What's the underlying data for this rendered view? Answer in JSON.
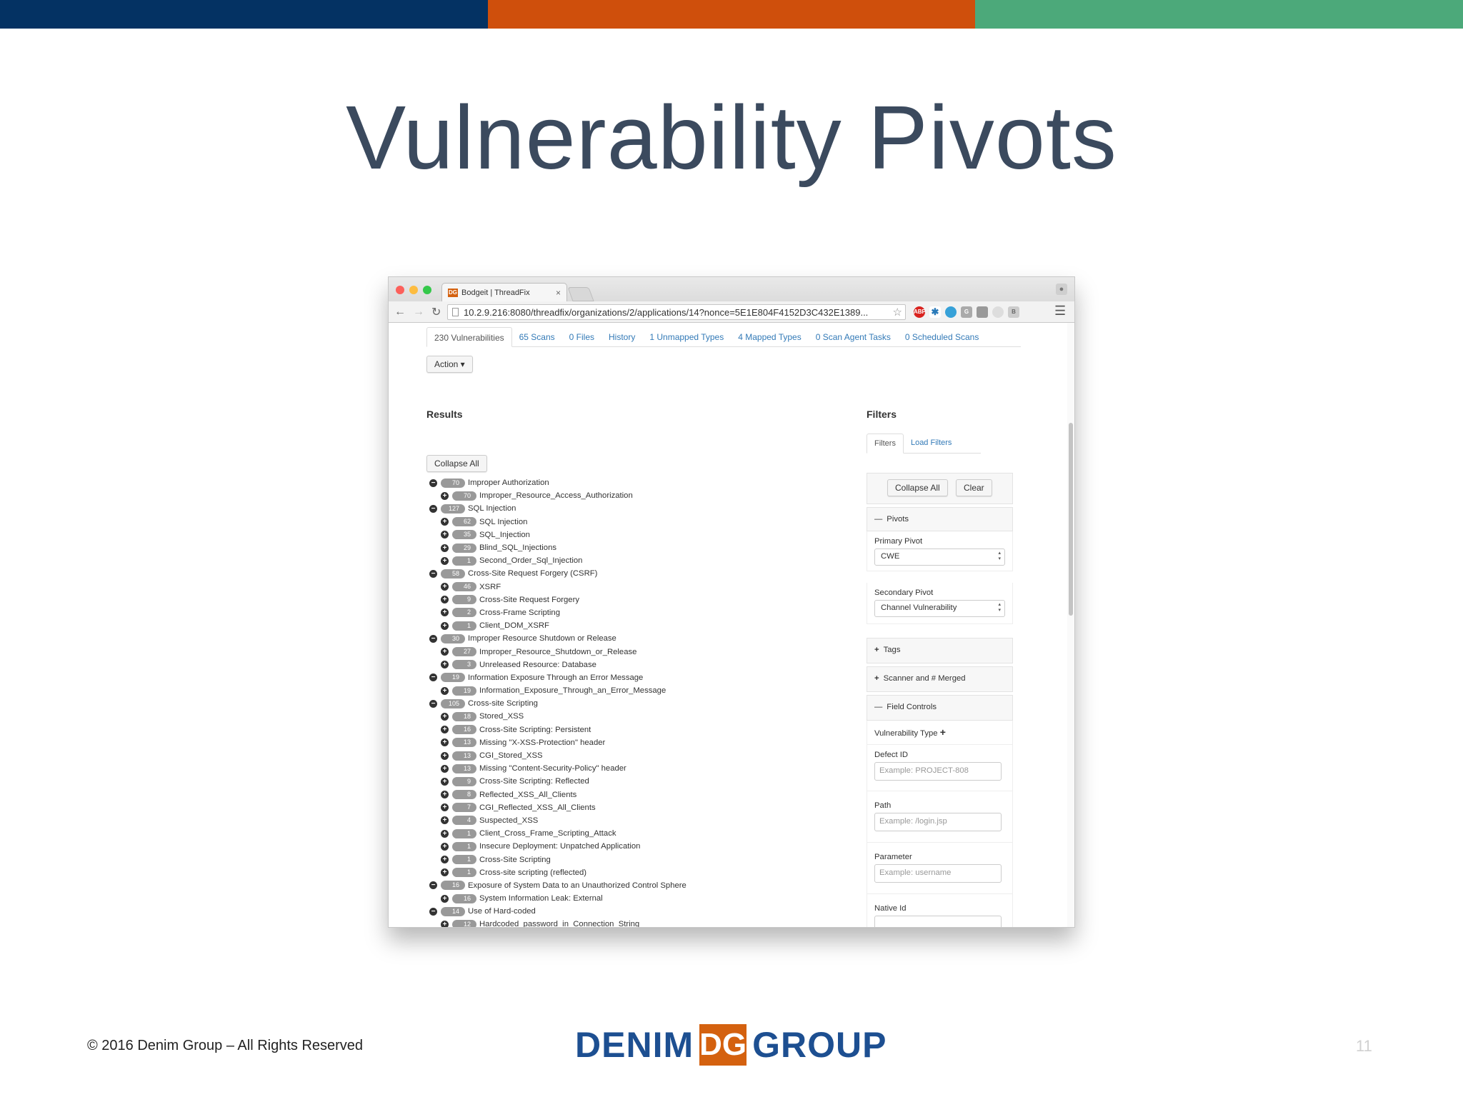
{
  "colors": {
    "bar_navy": "#043263",
    "bar_orange": "#cf4f0c",
    "bar_green": "#4ca97a",
    "link": "#337ab7",
    "logo_blue": "#1d4f91",
    "logo_orange": "#d4610f"
  },
  "slide": {
    "title": "Vulnerability Pivots",
    "footer": "© 2016 Denim Group – All Rights Reserved",
    "page_number": "11"
  },
  "logo": {
    "left_word": "DENIM",
    "right_word": "GROUP",
    "mark_text": "DG"
  },
  "browser": {
    "tab_title": "Bodgeit | ThreadFix",
    "tab_favicon": "DG",
    "tab_close": "×",
    "url": "10.2.9.216:8080/threadfix/organizations/2/applications/14?nonce=5E1E804F4152D3C432E1389...",
    "extensions": [
      "adblock-icon",
      "molecule-icon",
      "globe-icon",
      "g-icon",
      "square-icon",
      "moon-icon",
      "b-icon"
    ]
  },
  "app": {
    "tabs": [
      "230 Vulnerabilities",
      "65 Scans",
      "0 Files",
      "History",
      "1 Unmapped Types",
      "4 Mapped Types",
      "0 Scan Agent Tasks",
      "0 Scheduled Scans"
    ],
    "action_label": "Action ▾",
    "results_heading": "Results",
    "collapse_all": "Collapse All",
    "tree": [
      {
        "level": 0,
        "count": "70",
        "label": "Improper Authorization"
      },
      {
        "level": 1,
        "count": "70",
        "label": "Improper_Resource_Access_Authorization"
      },
      {
        "level": 0,
        "count": "127",
        "label": "SQL Injection"
      },
      {
        "level": 1,
        "count": "62",
        "label": "SQL Injection"
      },
      {
        "level": 1,
        "count": "35",
        "label": "SQL_Injection"
      },
      {
        "level": 1,
        "count": "29",
        "label": "Blind_SQL_Injections"
      },
      {
        "level": 1,
        "count": "1",
        "label": "Second_Order_Sql_Injection"
      },
      {
        "level": 0,
        "count": "58",
        "label": "Cross-Site Request Forgery (CSRF)"
      },
      {
        "level": 1,
        "count": "46",
        "label": "XSRF"
      },
      {
        "level": 1,
        "count": "9",
        "label": "Cross-Site Request Forgery"
      },
      {
        "level": 1,
        "count": "2",
        "label": "Cross-Frame Scripting"
      },
      {
        "level": 1,
        "count": "1",
        "label": "Client_DOM_XSRF"
      },
      {
        "level": 0,
        "count": "30",
        "label": "Improper Resource Shutdown or Release"
      },
      {
        "level": 1,
        "count": "27",
        "label": "Improper_Resource_Shutdown_or_Release"
      },
      {
        "level": 1,
        "count": "3",
        "label": "Unreleased Resource: Database"
      },
      {
        "level": 0,
        "count": "19",
        "label": "Information Exposure Through an Error Message"
      },
      {
        "level": 1,
        "count": "19",
        "label": "Information_Exposure_Through_an_Error_Message"
      },
      {
        "level": 0,
        "count": "105",
        "label": "Cross-site Scripting"
      },
      {
        "level": 1,
        "count": "18",
        "label": "Stored_XSS"
      },
      {
        "level": 1,
        "count": "16",
        "label": "Cross-Site Scripting: Persistent"
      },
      {
        "level": 1,
        "count": "13",
        "label": "Missing \"X-XSS-Protection\" header"
      },
      {
        "level": 1,
        "count": "13",
        "label": "CGI_Stored_XSS"
      },
      {
        "level": 1,
        "count": "13",
        "label": "Missing \"Content-Security-Policy\" header"
      },
      {
        "level": 1,
        "count": "9",
        "label": "Cross-Site Scripting: Reflected"
      },
      {
        "level": 1,
        "count": "8",
        "label": "Reflected_XSS_All_Clients"
      },
      {
        "level": 1,
        "count": "7",
        "label": "CGI_Reflected_XSS_All_Clients"
      },
      {
        "level": 1,
        "count": "4",
        "label": "Suspected_XSS"
      },
      {
        "level": 1,
        "count": "1",
        "label": "Client_Cross_Frame_Scripting_Attack"
      },
      {
        "level": 1,
        "count": "1",
        "label": "Insecure Deployment: Unpatched Application"
      },
      {
        "level": 1,
        "count": "1",
        "label": "Cross-Site Scripting"
      },
      {
        "level": 1,
        "count": "1",
        "label": "Cross-site scripting (reflected)"
      },
      {
        "level": 0,
        "count": "16",
        "label": "Exposure of System Data to an Unauthorized Control Sphere"
      },
      {
        "level": 1,
        "count": "16",
        "label": "System Information Leak: External"
      },
      {
        "level": 0,
        "count": "14",
        "label": "Use of Hard-coded"
      },
      {
        "level": 1,
        "count": "12",
        "label": "Hardcoded_password_in_Connection_String"
      }
    ],
    "filters": {
      "heading": "Filters",
      "tabs": [
        "Filters",
        "Load Filters"
      ],
      "collapse_all": "Collapse All",
      "clear": "Clear",
      "pivots_label": "Pivots",
      "primary_pivot_label": "Primary Pivot",
      "primary_pivot_value": "CWE",
      "secondary_pivot_label": "Secondary Pivot",
      "secondary_pivot_value": "Channel Vulnerability",
      "tags_label": "Tags",
      "scanner_label": "Scanner and # Merged",
      "field_controls_label": "Field Controls",
      "vuln_type_label": "Vulnerability Type",
      "defect_id_label": "Defect ID",
      "defect_id_placeholder": "Example: PROJECT-808",
      "path_label": "Path",
      "path_placeholder": "Example: /login.jsp",
      "parameter_label": "Parameter",
      "parameter_placeholder": "Example: username",
      "native_id_label": "Native Id"
    }
  }
}
